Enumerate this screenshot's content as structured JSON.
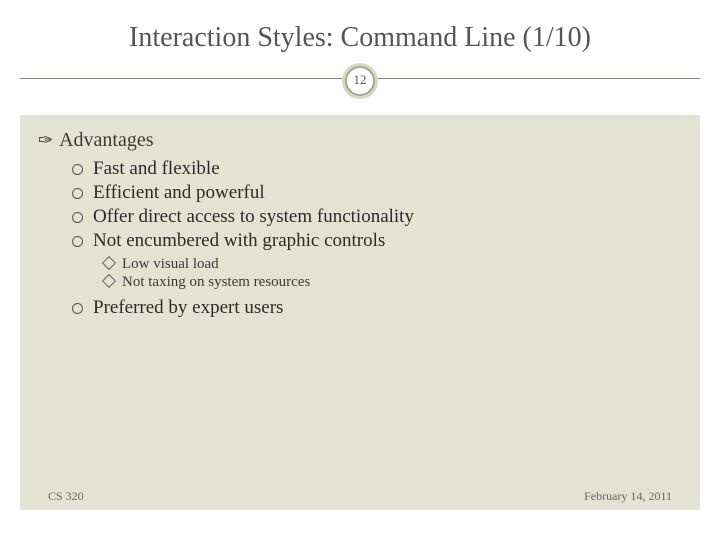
{
  "title": "Interaction Styles: Command Line (1/10)",
  "slide_number": "12",
  "heading": "Advantages",
  "points": [
    "Fast and flexible",
    "Efficient and powerful",
    "Offer direct access to system functionality",
    "Not encumbered with graphic controls"
  ],
  "subpoints": [
    "Low visual load",
    "Not taxing on system resources"
  ],
  "last_point": "Preferred by expert users",
  "footer_left": "CS 320",
  "footer_right": "February 14, 2011"
}
